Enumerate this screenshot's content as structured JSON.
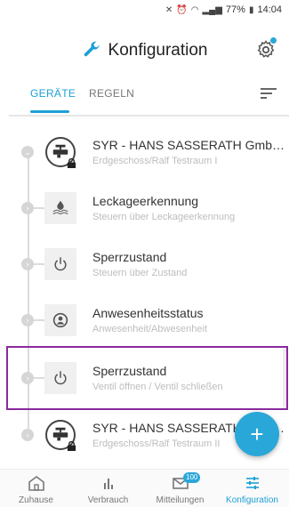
{
  "status_bar": {
    "battery": "77%",
    "time": "14:04"
  },
  "header": {
    "title": "Konfiguration"
  },
  "tabs": [
    {
      "label": "GERÄTE",
      "active": true
    },
    {
      "label": "REGELN",
      "active": false
    }
  ],
  "devices": [
    {
      "name": "SYR - HANS SASSERATH GmbH S...",
      "sub": "Erdgeschoss/Ralf Testraum I",
      "icon": "faucet-icon"
    },
    {
      "name": "Leckageerkennung",
      "sub": "Steuern über Leckageerkennung",
      "icon": "water-leak-icon"
    },
    {
      "name": "Sperrzustand",
      "sub": "Steuern über Zustand",
      "icon": "power-icon"
    },
    {
      "name": "Anwesenheitsstatus",
      "sub": "Anwesenheit/Abwesenheit",
      "icon": "presence-icon"
    },
    {
      "name": "Sperrzustand",
      "sub": "Ventil öffnen / Ventil schließen",
      "icon": "power-icon"
    },
    {
      "name": "SYR - HANS SASSERATH GmbH S...",
      "sub": "Erdgeschoss/Ralf Testraum II",
      "icon": "faucet-icon"
    }
  ],
  "fab": {
    "label": "+"
  },
  "bottom_nav": [
    {
      "label": "Zuhause",
      "icon": "home-icon"
    },
    {
      "label": "Verbrauch",
      "icon": "bar-chart-icon"
    },
    {
      "label": "Mitteilungen",
      "icon": "mail-icon",
      "badge": "100"
    },
    {
      "label": "Konfiguration",
      "icon": "sliders-icon",
      "active": true
    }
  ],
  "colors": {
    "accent": "#1ea0d6",
    "fab": "#2aa7d9",
    "selection": "#8a2a9e"
  }
}
